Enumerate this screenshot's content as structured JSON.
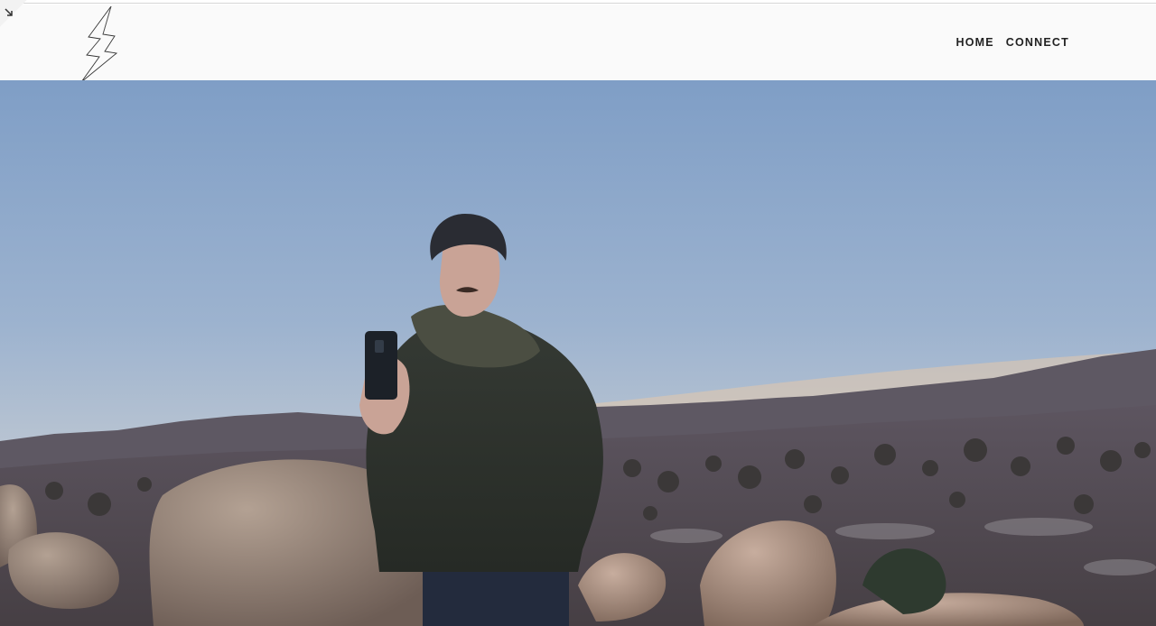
{
  "nav": {
    "items": [
      {
        "label": "HOME"
      },
      {
        "label": "CONNECT"
      }
    ]
  },
  "icons": {
    "logo": "lightning-bolt-icon",
    "corner": "expand-arrow-icon"
  },
  "colors": {
    "header_bg": "#fafafa",
    "nav_text": "#222222",
    "sky_top": "#7f9ec6",
    "sky_horizon": "#c9cfd6"
  }
}
